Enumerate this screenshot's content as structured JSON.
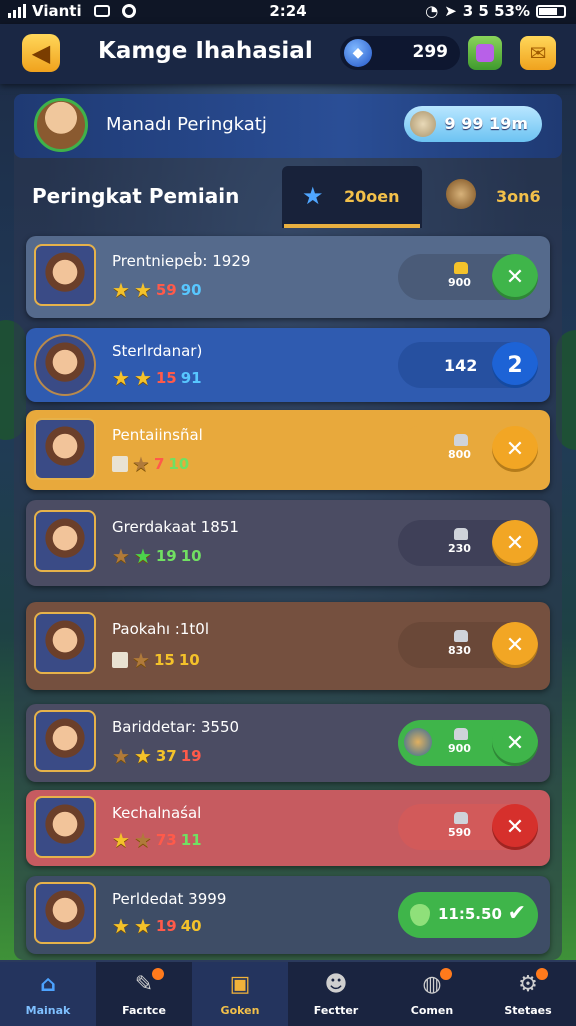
{
  "status_bar": {
    "carrier": "Vianti",
    "time": "2:24",
    "battery": "3 5 53%"
  },
  "header": {
    "title": "Kamge Ihahasial",
    "gems": "299"
  },
  "profile": {
    "name": "Manadı Peringkatj",
    "coins": "9 99 19m"
  },
  "section": {
    "title": "Peringkat Pemiain"
  },
  "tabs": [
    {
      "label": "20oen",
      "icon": "star-icon",
      "active": true
    },
    {
      "label": "3on6",
      "icon": "coin-icon",
      "active": false
    }
  ],
  "players": [
    {
      "name": "Prentniepeḃ: 1929",
      "score_a": "59",
      "score_b": "90",
      "pill_value": "900",
      "action": "x",
      "color": "#556a8c"
    },
    {
      "name": "Sterlrdanar)",
      "score_a": "15",
      "score_b": "91",
      "pill_value": "142",
      "action": "2",
      "color": "#2f5bb0"
    },
    {
      "name": "Pentaiinsñal",
      "score_a": "7",
      "score_b": "10",
      "pill_value": "800",
      "action": "x",
      "color": "#e8a93c"
    },
    {
      "name": "Grerdakaat 1851",
      "score_a": "19",
      "score_b": "10",
      "pill_value": "230",
      "action": "x",
      "color": "#4b4c63"
    },
    {
      "name": "Paokahı :1t0l",
      "score_a": "15",
      "score_b": "10",
      "pill_value": "830",
      "action": "x",
      "color": "#75503f"
    },
    {
      "name": "Bariddetar: 3550",
      "score_a": "37",
      "score_b": "19",
      "pill_value": "900",
      "action": "x",
      "color": "#4b4c63"
    },
    {
      "name": "Kechalnaśal",
      "score_a": "73",
      "score_b": "11",
      "pill_value": "590",
      "action": "x",
      "color": "#c65b60"
    },
    {
      "name": "Perldedat 3999",
      "score_a": "19",
      "score_b": "40",
      "pill_value": "11:5.50",
      "action": "✔",
      "color": "#3e4d66"
    }
  ],
  "nav": [
    {
      "label": "Mainak",
      "icon": "home-icon"
    },
    {
      "label": "Facıtce",
      "icon": "pencil-icon"
    },
    {
      "label": "Goken",
      "icon": "chest-icon"
    },
    {
      "label": "Fectter",
      "icon": "person-icon"
    },
    {
      "label": "Comen",
      "icon": "compass-icon"
    },
    {
      "label": "Stetaes",
      "icon": "gear-icon"
    }
  ]
}
